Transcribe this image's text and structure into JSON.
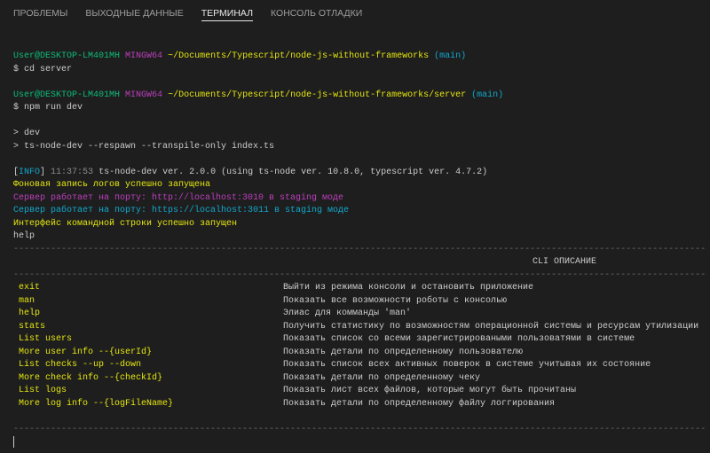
{
  "tabs": [
    "ПРОБЛЕМЫ",
    "ВЫХОДНЫЕ ДАННЫЕ",
    "ТЕРМИНАЛ",
    "КОНСОЛЬ ОТЛАДКИ"
  ],
  "active_tab": "ТЕРМИНАЛ",
  "prompt1": {
    "user": "User@DESKTOP-LM401MH",
    "shell": "MINGW64",
    "path": "~/Documents/Typescript/node-js-without-frameworks",
    "branch": "(main)",
    "command": "$ cd server"
  },
  "prompt2": {
    "user": "User@DESKTOP-LM401MH",
    "shell": "MINGW64",
    "path": "~/Documents/Typescript/node-js-without-frameworks/server",
    "branch": "(main)",
    "command": "$ npm run dev"
  },
  "npm_lines": [
    "> dev",
    "> ts-node-dev --respawn --transpile-only index.ts"
  ],
  "info": {
    "tag": "INFO",
    "time": "11:37:53",
    "text": "ts-node-dev ver. 2.0.0 (using ts-node ver. 10.8.0, typescript ver. 4.7.2)"
  },
  "log_started": "Фоновая запись логов успешно запущена",
  "http_server": "Сервер работает на порту: http://localhost:3010 в staging моде",
  "https_server": "Сервер работает на порту: https://localhost:3011 в staging моде",
  "cli_started": "Интерфейс командной строки успешно запущен",
  "typed": "help",
  "cli_header": "CLI ОПИСАНИЕ",
  "commands": [
    {
      "cmd": "exit",
      "desc": "Выйти из режима консоли и остановить приложение"
    },
    {
      "cmd": "man",
      "desc": "Показать все возможности роботы с консолью"
    },
    {
      "cmd": "help",
      "desc": "Элиас для комманды 'man'"
    },
    {
      "cmd": "stats",
      "desc": "Получить статистику по возможностям операционной системы и ресурсам утилизации"
    },
    {
      "cmd": "List users",
      "desc": "Показать список со всеми зарегистрироваными пользоватями в системе"
    },
    {
      "cmd": "More user info --{userId}",
      "desc": "Показать детали по определенному пользователю"
    },
    {
      "cmd": "List checks --up --down",
      "desc": "Показать список всех активных поверок в системе учитывая их состояние"
    },
    {
      "cmd": "More check info --{checkId}",
      "desc": "Показать детали по определенному чеку"
    },
    {
      "cmd": "List logs",
      "desc": "Показать лист всех файлов, которые могут быть прочитаны"
    },
    {
      "cmd": "More log info --{logFileName}",
      "desc": "Показать детали по определенному файлу логгирования"
    }
  ]
}
